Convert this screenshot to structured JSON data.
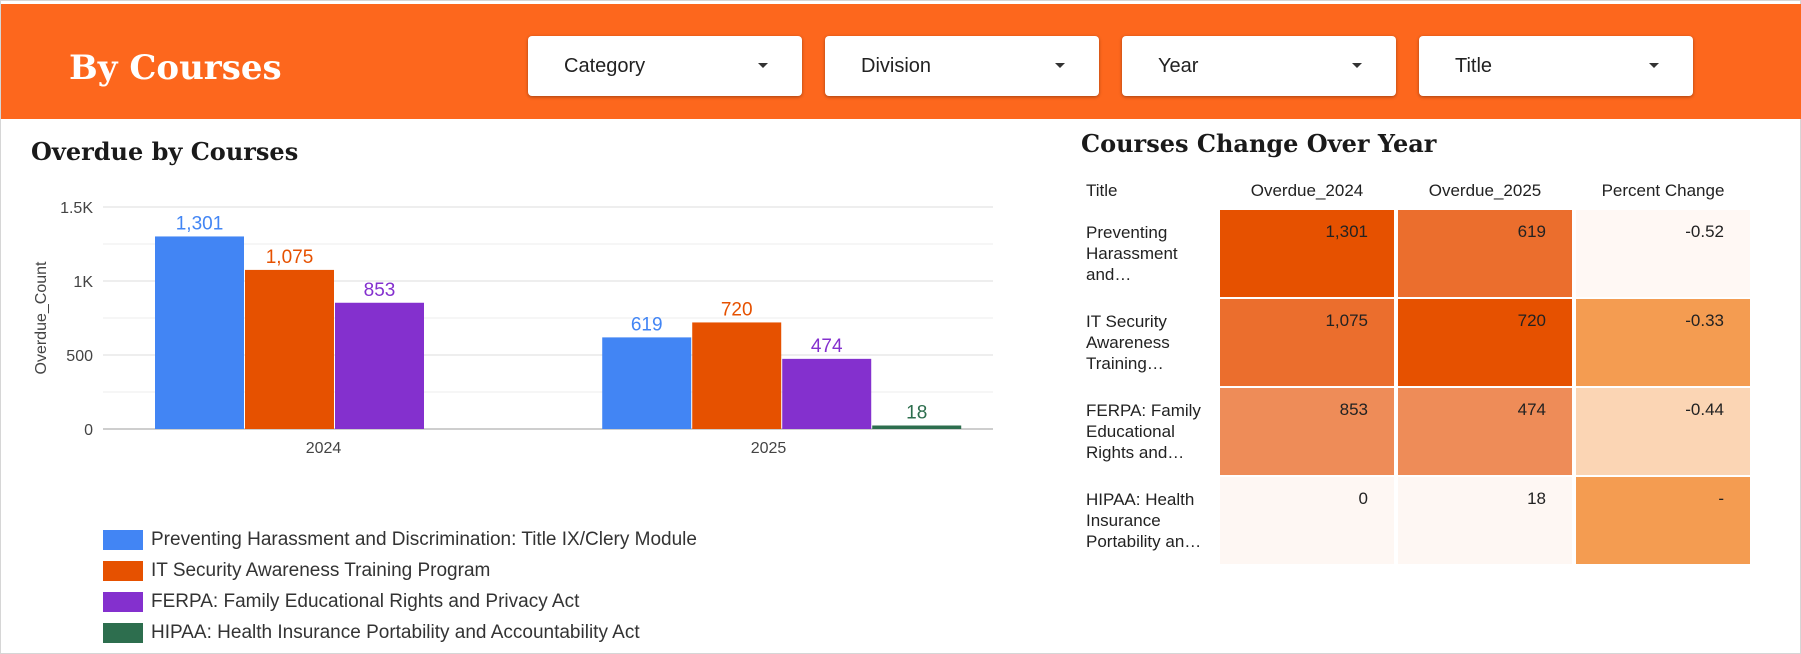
{
  "header": {
    "title": "By Courses",
    "filters": [
      {
        "label": "Category"
      },
      {
        "label": "Division"
      },
      {
        "label": "Year"
      },
      {
        "label": "Title"
      }
    ]
  },
  "overdue_chart": {
    "title": "Overdue by Courses",
    "legend": [
      {
        "label": "Preventing Harassment and Discrimination: Title IX/Clery Module",
        "color": "#4285f4"
      },
      {
        "label": "IT Security Awareness Training Program",
        "color": "#e65100"
      },
      {
        "label": "FERPA: Family Educational Rights and Privacy Act",
        "color": "#8430ce"
      },
      {
        "label": "HIPAA: Health Insurance Portability and Accountability Act",
        "color": "#2d6e4e"
      }
    ]
  },
  "chart_data": {
    "type": "bar",
    "title": "Overdue by Courses",
    "xlabel": "",
    "ylabel": "Overdue_Count",
    "categories": [
      "2024",
      "2025"
    ],
    "ylim": [
      0,
      1500
    ],
    "yticks": [
      0,
      500,
      1000,
      1500
    ],
    "ytick_labels": [
      "0",
      "500",
      "1K",
      "1.5K"
    ],
    "grid": true,
    "legend_position": "bottom-left",
    "series": [
      {
        "name": "Preventing Harassment and Discrimination: Title IX/Clery Module",
        "color": "#4285f4",
        "values": [
          1301,
          619
        ],
        "labels": [
          "1,301",
          "619"
        ]
      },
      {
        "name": "IT Security Awareness Training Program",
        "color": "#e65100",
        "values": [
          1075,
          720
        ],
        "labels": [
          "1,075",
          "720"
        ]
      },
      {
        "name": "FERPA: Family Educational Rights and Privacy Act",
        "color": "#8430ce",
        "values": [
          853,
          474
        ],
        "labels": [
          "853",
          "474"
        ]
      },
      {
        "name": "HIPAA: Health Insurance Portability and Accountability Act",
        "color": "#2d6e4e",
        "values": [
          null,
          18
        ],
        "labels": [
          "",
          "18"
        ]
      }
    ]
  },
  "change_table": {
    "title": "Courses Change Over Year",
    "columns": [
      "Title",
      "Overdue_2024",
      "Overdue_2025",
      "Percent Change"
    ],
    "rows": [
      {
        "title": "Preventing Harassment and…",
        "cells": [
          {
            "text": "1,301",
            "color": "#e65100"
          },
          {
            "text": "619",
            "color": "#eb6e2d"
          },
          {
            "text": "-0.52",
            "color": "#fff8f4"
          }
        ]
      },
      {
        "title": "IT Security Awareness Training…",
        "cells": [
          {
            "text": "1,075",
            "color": "#eb6e2d"
          },
          {
            "text": "720",
            "color": "#e65100"
          },
          {
            "text": "-0.33",
            "color": "#f49c51"
          }
        ]
      },
      {
        "title": "FERPA: Family Educational Rights and…",
        "cells": [
          {
            "text": "853",
            "color": "#ee8c58"
          },
          {
            "text": "474",
            "color": "#ee8c58"
          },
          {
            "text": "-0.44",
            "color": "#fbd5b4"
          }
        ]
      },
      {
        "title": "HIPAA: Health Insurance Portability an…",
        "cells": [
          {
            "text": "0",
            "color": "#fef7f3"
          },
          {
            "text": "18",
            "color": "#fef7f3"
          },
          {
            "text": "-",
            "color": "#f49c51"
          }
        ]
      }
    ]
  }
}
